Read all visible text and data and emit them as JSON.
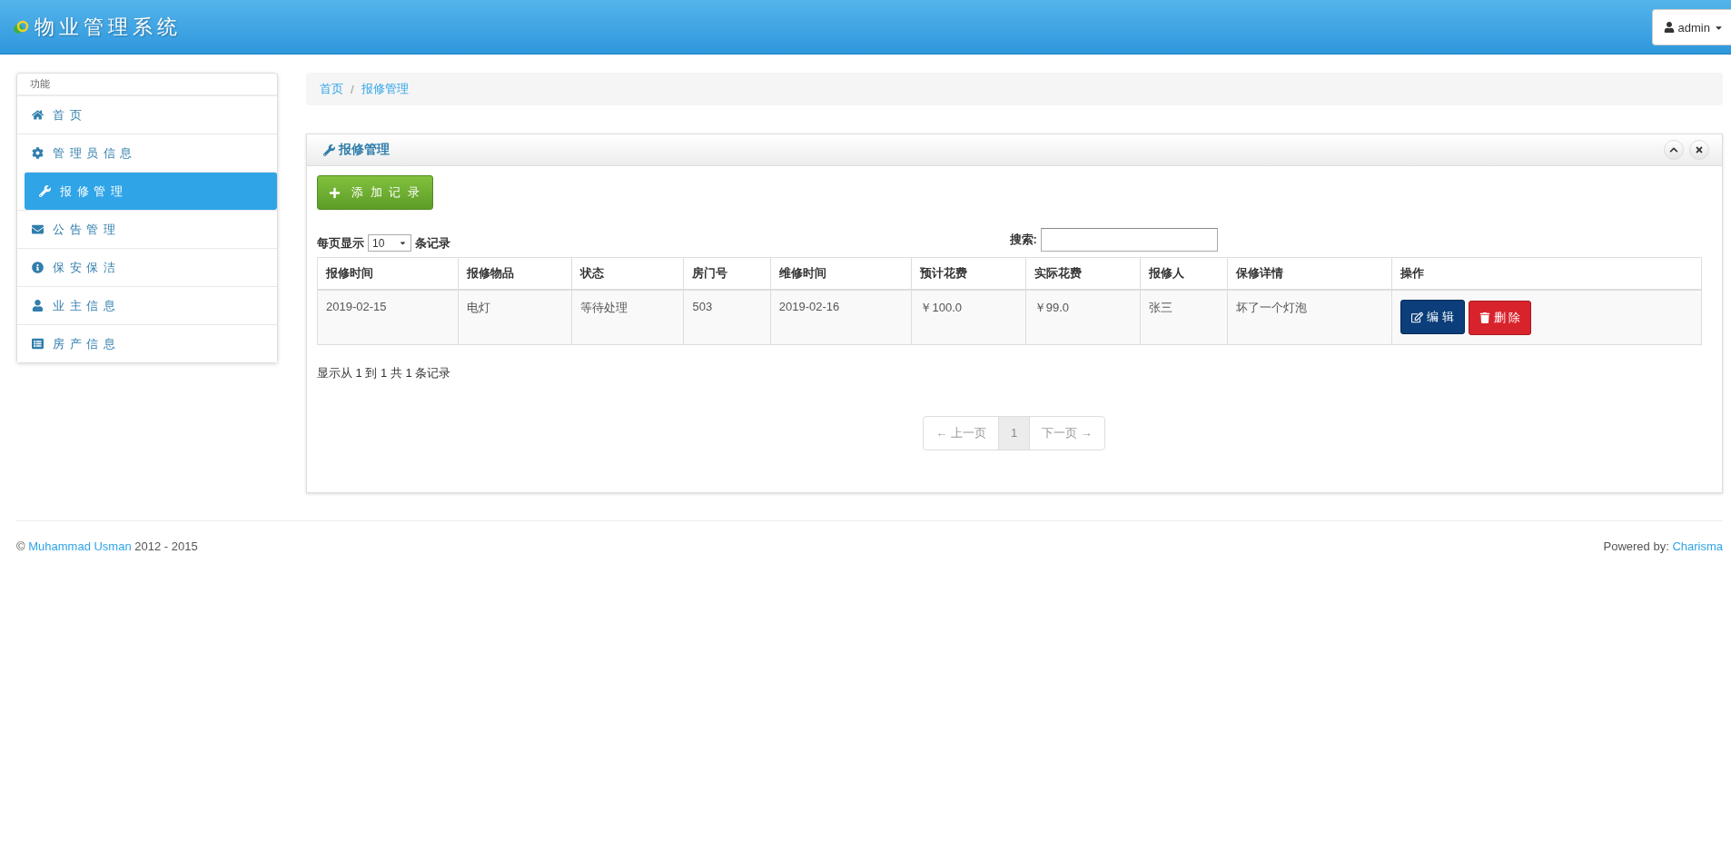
{
  "header": {
    "title": "物业管理系统",
    "user": "admin"
  },
  "sidebar": {
    "heading": "功能",
    "items": [
      {
        "label": "首 页",
        "selected": false
      },
      {
        "label": "管 理 员 信 息",
        "selected": false
      },
      {
        "label": "报 修 管 理",
        "selected": true
      },
      {
        "label": "公 告 管 理",
        "selected": false
      },
      {
        "label": "保 安 保 洁",
        "selected": false
      },
      {
        "label": "业 主 信 息",
        "selected": false
      },
      {
        "label": "房 产 信 息",
        "selected": false
      }
    ]
  },
  "breadcrumb": {
    "items": [
      "首页",
      "报修管理"
    ],
    "separator": "/"
  },
  "panel": {
    "title": "报修管理",
    "add_button": "添 加 记 录",
    "length": {
      "before": "每页显示",
      "value": "10",
      "after": "条记录"
    },
    "search_label": "搜索:",
    "columns": [
      "报修时间",
      "报修物品",
      "状态",
      "房门号",
      "维修时间",
      "预计花费",
      "实际花费",
      "报修人",
      "保修详情",
      "操作"
    ],
    "rows": [
      {
        "cells": [
          "2019-02-15",
          "电灯",
          "等待处理",
          "503",
          "2019-02-16",
          "￥100.0",
          "￥99.0",
          "张三",
          "坏了一个灯泡"
        ],
        "edit": "编 辑",
        "delete": "删 除"
      }
    ],
    "info": "显示从 1 到 1 共 1 条记录",
    "pagination": [
      {
        "label": "← 上一页",
        "selected": false,
        "disabled": true
      },
      {
        "label": "1",
        "selected": true,
        "disabled": false
      },
      {
        "label": "下一页 →",
        "selected": false,
        "disabled": true
      }
    ]
  },
  "footer": {
    "copyright": "©",
    "author": "Muhammad Usman",
    "years": "2012 - 2015",
    "powered": "Powered by:",
    "powered_link": "Charisma"
  }
}
